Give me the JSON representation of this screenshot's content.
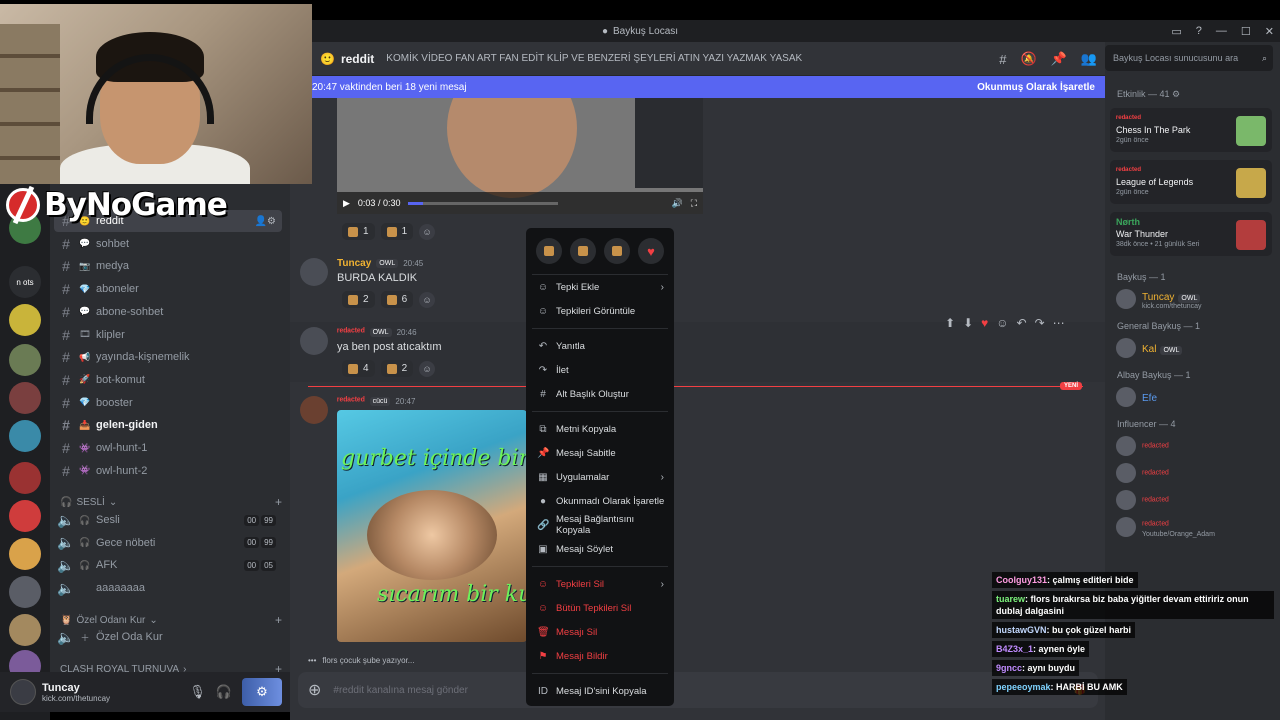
{
  "window": {
    "title": "Baykuş Locası"
  },
  "brand": {
    "text": "ByNoGame"
  },
  "sidebar": {
    "channels": [
      {
        "name": "reddit",
        "emoji": "🙂",
        "selected": true
      },
      {
        "name": "sohbet",
        "emoji": "💬"
      },
      {
        "name": "medya",
        "emoji": "📷"
      },
      {
        "name": "aboneler",
        "emoji": "💎"
      },
      {
        "name": "abone-sohbet",
        "emoji": "💬"
      },
      {
        "name": "klipler",
        "emoji": "🎞"
      },
      {
        "name": "yayında-kişnemelik",
        "emoji": "📢"
      },
      {
        "name": "bot-komut",
        "emoji": "🚀"
      },
      {
        "name": "booster",
        "emoji": "💎"
      },
      {
        "name": "gelen-giden",
        "emoji": "📥",
        "active": true
      },
      {
        "name": "owl-hunt-1",
        "emoji": "👾"
      },
      {
        "name": "owl-hunt-2",
        "emoji": "👾"
      }
    ],
    "voice_category": "SESLİ",
    "voice_channels": [
      {
        "name": "Sesli",
        "counts": [
          "00",
          "99"
        ]
      },
      {
        "name": "Gece nöbeti",
        "counts": [
          "00",
          "99"
        ]
      },
      {
        "name": "AFK",
        "counts": [
          "00",
          "05"
        ]
      },
      {
        "name": "aaaaaaaa",
        "counts": []
      }
    ],
    "private_category": "Özel Odanı Kur",
    "private_channel": "Özel Oda Kur",
    "next_category": "CLASH ROYAL TURNUVA",
    "rail_labels": [
      "n",
      "ots"
    ]
  },
  "user": {
    "name": "Tuncay",
    "status": "kick.com/thetuncay"
  },
  "header": {
    "channel": "reddit",
    "topic": "KOMİK VİDEO FAN ART FAN EDİT KLİP VE BENZERİ ŞEYLERİ ATIN YAZI YAZMAK YASAK",
    "new_messages": "20:47 vaktinden beri 18 yeni mesaj",
    "mark_read": "Okunmuş Olarak İşaretle"
  },
  "video": {
    "time": "0:03 / 0:30",
    "progress": 0.1
  },
  "messages": [
    {
      "author": "Tuncay",
      "tag": "OWL",
      "time": "20:45",
      "text": "BURDA KALDIK",
      "color": "#f0b232"
    },
    {
      "author": "ʳᵉᵈᵃᶜᵗᵉᵈ",
      "tag": "OWL",
      "time": "20:46",
      "text": "ya ben post atıcaktım",
      "color": "#f23f43"
    },
    {
      "author": "ʳᵉᵈᵃᶜᵗᵉᵈ",
      "tag": "cücü",
      "time": "20:47",
      "text": "",
      "color": "#f23f43"
    }
  ],
  "reactions": {
    "r1": [
      "1",
      "1"
    ],
    "r2": [
      "2",
      "6"
    ],
    "r3": [
      "4",
      "2"
    ]
  },
  "new_tag": "YENİ",
  "cat_image": {
    "line1": "gurbet içinde bir",
    "line2": "sıcarım bir kurg"
  },
  "typing": "flors çocuk şube yazıyor...",
  "composer": {
    "placeholder": "#reddit kanalına mesaj gönder"
  },
  "context_menu": {
    "items": [
      {
        "label": "Tepki Ekle",
        "icon": "☺",
        "arrow": true
      },
      {
        "label": "Tepkileri Görüntüle",
        "icon": "☺"
      },
      {
        "sep": true
      },
      {
        "label": "Yanıtla",
        "icon": "↶"
      },
      {
        "label": "İlet",
        "icon": "↷"
      },
      {
        "label": "Alt Başlık Oluştur",
        "icon": "#"
      },
      {
        "sep": true
      },
      {
        "label": "Metni Kopyala",
        "icon": "⧉"
      },
      {
        "label": "Mesajı Sabitle",
        "icon": "📌"
      },
      {
        "label": "Uygulamalar",
        "icon": "▦",
        "arrow": true
      },
      {
        "label": "Okunmadı Olarak İşaretle",
        "icon": "●"
      },
      {
        "label": "Mesaj Bağlantısını Kopyala",
        "icon": "🔗"
      },
      {
        "label": "Mesajı Söylet",
        "icon": "▣"
      },
      {
        "sep": true
      },
      {
        "label": "Tepkileri Sil",
        "icon": "☺",
        "arrow": true,
        "danger": true
      },
      {
        "label": "Bütün Tepkileri Sil",
        "icon": "☺",
        "danger": true
      },
      {
        "label": "Mesajı Sil",
        "icon": "🗑",
        "danger": true
      },
      {
        "label": "Mesajı Bildir",
        "icon": "⚑",
        "danger": true
      },
      {
        "sep": true
      },
      {
        "label": "Mesaj ID'sini Kopyala",
        "icon": "ID"
      }
    ]
  },
  "members": {
    "search_placeholder": "Baykuş Locası sunucusunu ara",
    "activity_header": "Etkinlik — 41",
    "activities": [
      {
        "user": "ʳᵉᵈᵃᶜᵗᵉᵈ",
        "title": "Chess In The Park",
        "meta": "2gün önce",
        "color": "#f23f43"
      },
      {
        "user": "ʳᵉᵈᵃᶜᵗᵉᵈ",
        "title": "League of Legends",
        "meta": "2gün önce",
        "color": "#f23f43"
      },
      {
        "user": "Nørth",
        "title": "War Thunder",
        "meta": "38dk önce  •  21 günlük Seri",
        "color": "#3ba55c"
      }
    ],
    "groups": [
      {
        "label": "Baykuş — 1",
        "members": [
          {
            "name": "Tuncay",
            "sub": "kick.com/thetuncay",
            "tag": "OWL",
            "color": "#f0b232"
          }
        ]
      },
      {
        "label": "General Baykuş — 1",
        "members": [
          {
            "name": "Kal",
            "tag": "OWL",
            "color": "#f0b232"
          }
        ]
      },
      {
        "label": "Albay Baykuş — 1",
        "members": [
          {
            "name": "Efe",
            "color": "#5b9bf0"
          }
        ]
      },
      {
        "label": "Influencer — 4",
        "members": [
          {
            "name": "ʳᵉᵈᵃᶜᵗᵉᵈ",
            "color": "#f23f43"
          },
          {
            "name": "ʳᵉᵈᵃᶜᵗᵉᵈ",
            "color": "#f23f43"
          },
          {
            "name": "ʳᵉᵈᵃᶜᵗᵉᵈ",
            "color": "#f23f43"
          },
          {
            "name": "ʳᵉᵈᵃᶜᵗᵉᵈ",
            "sub": "Youtube/Orange_Adam",
            "color": "#f23f43"
          }
        ]
      }
    ]
  },
  "stream_chat": [
    {
      "user": "Coolguy131",
      "text": "çalmış editleri bide",
      "color": "#ff9de2"
    },
    {
      "user": "tuarew",
      "text": "flors bırakırsa biz baba yiğitler devam ettiririz onun dublaj dalgasini",
      "color": "#7cf27c"
    },
    {
      "user": "hustawGVN",
      "text": "bu çok güzel harbi",
      "color": "#c3d9ff"
    },
    {
      "user": "B4Z3x_1",
      "text": "aynen öyle",
      "color": "#c08bff"
    },
    {
      "user": "9gncc",
      "text": "aynı buydu",
      "color": "#c08bff"
    },
    {
      "user": "pepeeoymak",
      "text": "HARBİ BU AMK",
      "color": "#7fd3ff"
    }
  ]
}
